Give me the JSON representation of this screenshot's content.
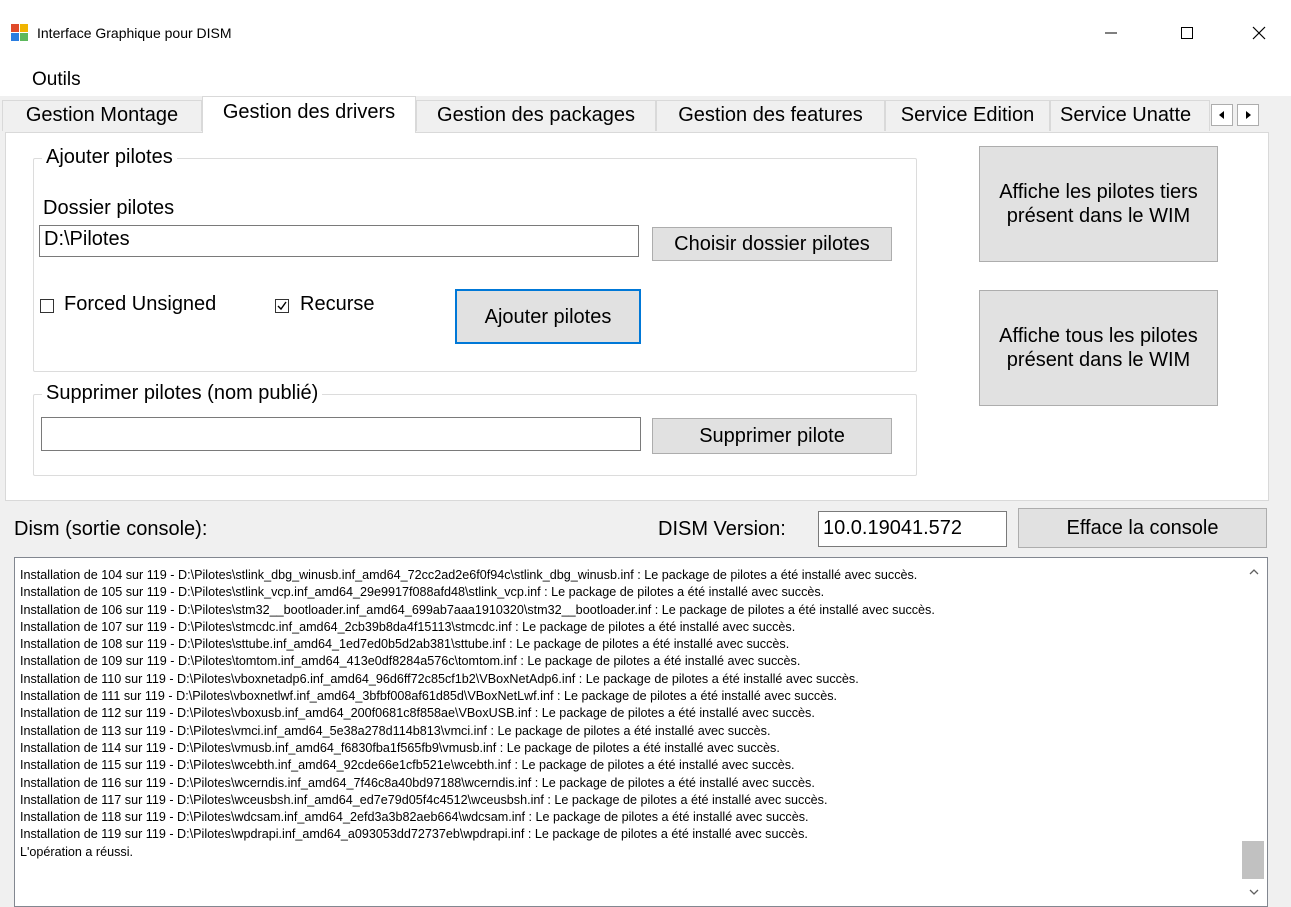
{
  "window": {
    "title": "Interface Graphique pour DISM"
  },
  "menu": {
    "items": [
      {
        "label": "Outils"
      }
    ]
  },
  "tabs": [
    {
      "label": "Gestion Montage",
      "active": false
    },
    {
      "label": "Gestion des drivers",
      "active": true
    },
    {
      "label": "Gestion des packages",
      "active": false
    },
    {
      "label": "Gestion des features",
      "active": false
    },
    {
      "label": "Service Edition",
      "active": false
    },
    {
      "label": "Service Unatte",
      "active": false
    }
  ],
  "add_drivers": {
    "group_label": "Ajouter pilotes",
    "folder_label": "Dossier pilotes",
    "folder_value": "D:\\Pilotes",
    "choose_folder_button": "Choisir dossier pilotes",
    "forced_unsigned_label": "Forced Unsigned",
    "forced_unsigned_checked": false,
    "recurse_label": "Recurse",
    "recurse_checked": true,
    "add_button": "Ajouter pilotes"
  },
  "remove_drivers": {
    "group_label": "Supprimer pilotes (nom publié)",
    "name_value": "",
    "remove_button": "Supprimer pilote"
  },
  "side_buttons": {
    "third_party": "Affiche les pilotes tiers présent dans le WIM",
    "all_drivers": "Affiche tous les pilotes présent dans le WIM"
  },
  "console": {
    "label": "Dism (sortie console):",
    "version_label": "DISM Version:",
    "version_value": "10.0.19041.572",
    "clear_button": "Efface la console",
    "lines": [
      "Installation de 104 sur 119 - D:\\Pilotes\\stlink_dbg_winusb.inf_amd64_72cc2ad2e6f0f94c\\stlink_dbg_winusb.inf : Le package de pilotes a été installé avec succès.",
      "Installation de 105 sur 119 - D:\\Pilotes\\stlink_vcp.inf_amd64_29e9917f088afd48\\stlink_vcp.inf : Le package de pilotes a été installé avec succès.",
      "Installation de 106 sur 119 - D:\\Pilotes\\stm32__bootloader.inf_amd64_699ab7aaa1910320\\stm32__bootloader.inf : Le package de pilotes a été installé avec succès.",
      "Installation de 107 sur 119 - D:\\Pilotes\\stmcdc.inf_amd64_2cb39b8da4f15113\\stmcdc.inf : Le package de pilotes a été installé avec succès.",
      "Installation de 108 sur 119 - D:\\Pilotes\\sttube.inf_amd64_1ed7ed0b5d2ab381\\sttube.inf : Le package de pilotes a été installé avec succès.",
      "Installation de 109 sur 119 - D:\\Pilotes\\tomtom.inf_amd64_413e0df8284a576c\\tomtom.inf : Le package de pilotes a été installé avec succès.",
      "Installation de 110 sur 119 - D:\\Pilotes\\vboxnetadp6.inf_amd64_96d6ff72c85cf1b2\\VBoxNetAdp6.inf : Le package de pilotes a été installé avec succès.",
      "Installation de 111 sur 119 - D:\\Pilotes\\vboxnetlwf.inf_amd64_3bfbf008af61d85d\\VBoxNetLwf.inf : Le package de pilotes a été installé avec succès.",
      "Installation de 112 sur 119 - D:\\Pilotes\\vboxusb.inf_amd64_200f0681c8f858ae\\VBoxUSB.inf : Le package de pilotes a été installé avec succès.",
      "Installation de 113 sur 119 - D:\\Pilotes\\vmci.inf_amd64_5e38a278d114b813\\vmci.inf : Le package de pilotes a été installé avec succès.",
      "Installation de 114 sur 119 - D:\\Pilotes\\vmusb.inf_amd64_f6830fba1f565fb9\\vmusb.inf : Le package de pilotes a été installé avec succès.",
      "Installation de 115 sur 119 - D:\\Pilotes\\wcebth.inf_amd64_92cde66e1cfb521e\\wcebth.inf : Le package de pilotes a été installé avec succès.",
      "Installation de 116 sur 119 - D:\\Pilotes\\wcerndis.inf_amd64_7f46c8a40bd97188\\wcerndis.inf : Le package de pilotes a été installé avec succès.",
      "Installation de 117 sur 119 - D:\\Pilotes\\wceusbsh.inf_amd64_ed7e79d05f4c4512\\wceusbsh.inf : Le package de pilotes a été installé avec succès.",
      "Installation de 118 sur 119 - D:\\Pilotes\\wdcsam.inf_amd64_2efd3a3b82aeb664\\wdcsam.inf : Le package de pilotes a été installé avec succès.",
      "Installation de 119 sur 119 - D:\\Pilotes\\wpdrapi.inf_amd64_a093053dd72737eb\\wpdrapi.inf : Le package de pilotes a été installé avec succès.",
      "L'opération a réussi."
    ]
  },
  "icons": {
    "app": "app-window-icon",
    "minimize": "minimize-icon",
    "maximize": "maximize-icon",
    "close": "close-icon",
    "tab_left": "chevron-left-icon",
    "tab_right": "chevron-right-icon",
    "scroll_up": "chevron-up-icon",
    "scroll_down": "chevron-down-icon",
    "checkmark": "checkmark-icon"
  },
  "colors": {
    "focus_border": "#0078d7",
    "button_face": "#e1e1e1",
    "window_bg": "#f0f0f0"
  }
}
